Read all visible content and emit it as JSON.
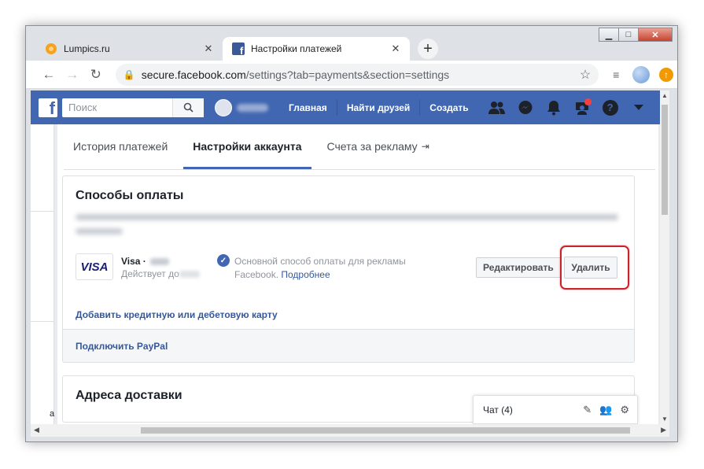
{
  "browser": {
    "tabs": [
      {
        "title": "Lumpics.ru",
        "icon": "lumpics-favicon"
      },
      {
        "title": "Настройки платежей",
        "icon": "facebook-favicon"
      }
    ],
    "close_glyph": "✕",
    "new_tab_glyph": "+",
    "url_host": "secure.facebook.com",
    "url_path": "/settings?tab=payments&section=settings",
    "window_controls": {
      "minimize": "▁",
      "maximize": "□",
      "close": "✕"
    }
  },
  "facebook": {
    "logo": "f",
    "search_placeholder": "Поиск",
    "nav_links": {
      "home": "Главная",
      "find_friends": "Найти друзей",
      "create": "Создать"
    },
    "brand_color": "#4267b2"
  },
  "settings": {
    "subtabs": {
      "history": "История платежей",
      "account": "Настройки аккаунта",
      "ad_accounts": "Счета за рекламу"
    },
    "payment_methods": {
      "title": "Способы оплаты",
      "card_brand_logo": "VISA",
      "card_name": "Visa ·",
      "card_valid": "Действует до",
      "primary_text": "Основной способ оплаты для рекламы Facebook.",
      "more_link": "Подробнее",
      "edit_button": "Редактировать",
      "delete_button": "Удалить",
      "add_card_link": "Добавить кредитную или дебетовую карту",
      "paypal_link": "Подключить PayPal"
    },
    "shipping": {
      "title": "Адреса доставки"
    }
  },
  "chat": {
    "label": "Чат (4)"
  },
  "annotation": {
    "highlight_color": "#c8232c"
  }
}
